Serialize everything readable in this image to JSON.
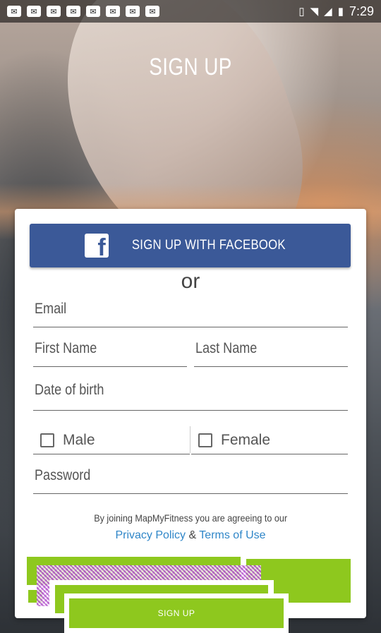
{
  "status_bar": {
    "time": "7:29",
    "notification_icons": [
      "notification-icon",
      "notification-icon",
      "notification-icon",
      "notification-icon",
      "notification-icon",
      "notification-icon",
      "notification-icon",
      "notification-icon"
    ],
    "system_icons": [
      "vibrate-icon",
      "wifi-icon",
      "signal-icon",
      "battery-icon"
    ]
  },
  "header": {
    "title": "SIGN UP"
  },
  "facebook": {
    "label": "SIGN UP WITH FACEBOOK",
    "icon": "facebook-icon"
  },
  "or_text": "or",
  "form": {
    "email_placeholder": "Email",
    "first_name_placeholder": "First Name",
    "last_name_placeholder": "Last Name",
    "dob_placeholder": "Date of birth",
    "male_label": "Male",
    "female_label": "Female",
    "password_placeholder": "Password"
  },
  "terms": {
    "text": "By joining MapMyFitness you are agreeing to our",
    "privacy_label": "Privacy Policy",
    "ampersand": "&",
    "terms_label": "Terms of Use"
  },
  "signup_button": {
    "label": "SIGN UP"
  },
  "colors": {
    "facebook_blue": "#3b5998",
    "accent_green": "#8ec81e",
    "link_blue": "#2f86c8"
  }
}
